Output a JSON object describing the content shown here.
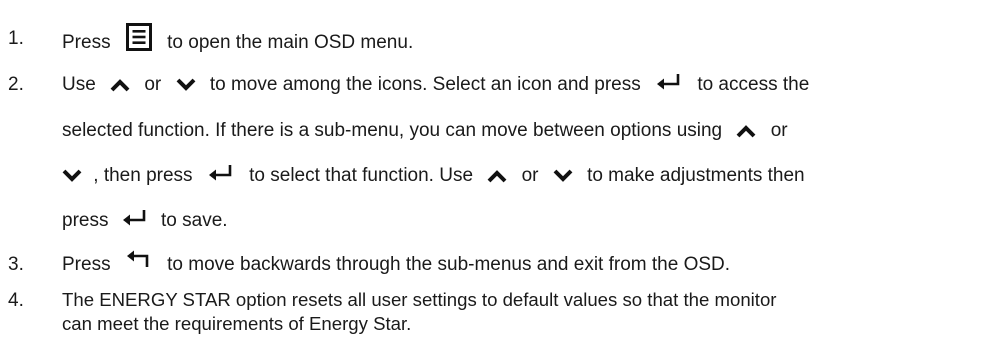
{
  "steps": [
    {
      "number": "1.",
      "lines": [
        {
          "t1": "Press",
          "icon1": "menu-icon",
          "t2": "to open the main OSD menu."
        }
      ]
    },
    {
      "number": "2.",
      "lines": [
        {
          "t1": "Use",
          "icon1": "up-arrow-icon",
          "t2": "or",
          "icon2": "down-arrow-icon",
          "t3": "to move among the icons. Select an icon and press",
          "icon3": "enter-icon",
          "t4": "to access the"
        },
        {
          "t1": "selected function. If there is a sub-menu, you can move between options using",
          "icon1": "up-arrow-icon",
          "t2": "or"
        },
        {
          "icon1": "down-arrow-icon",
          "t1": ", then press",
          "icon2": "enter-icon",
          "t2": "to select that function. Use",
          "icon3": "up-arrow-icon",
          "t3": "or",
          "icon4": "down-arrow-icon",
          "t4": "to make adjustments then"
        },
        {
          "t1": "press",
          "icon1": "enter-icon",
          "t2": "to save."
        }
      ]
    },
    {
      "number": "3.",
      "lines": [
        {
          "t1": "Press",
          "icon1": "back-icon",
          "t2": "to move backwards through the sub-menus and exit from the OSD."
        }
      ]
    },
    {
      "number": "4.",
      "lines": [
        {
          "t1": "The ENERGY STAR option resets all user settings to default values so that the monitor"
        },
        {
          "t1": "can meet the requirements of Energy Star."
        }
      ]
    }
  ]
}
